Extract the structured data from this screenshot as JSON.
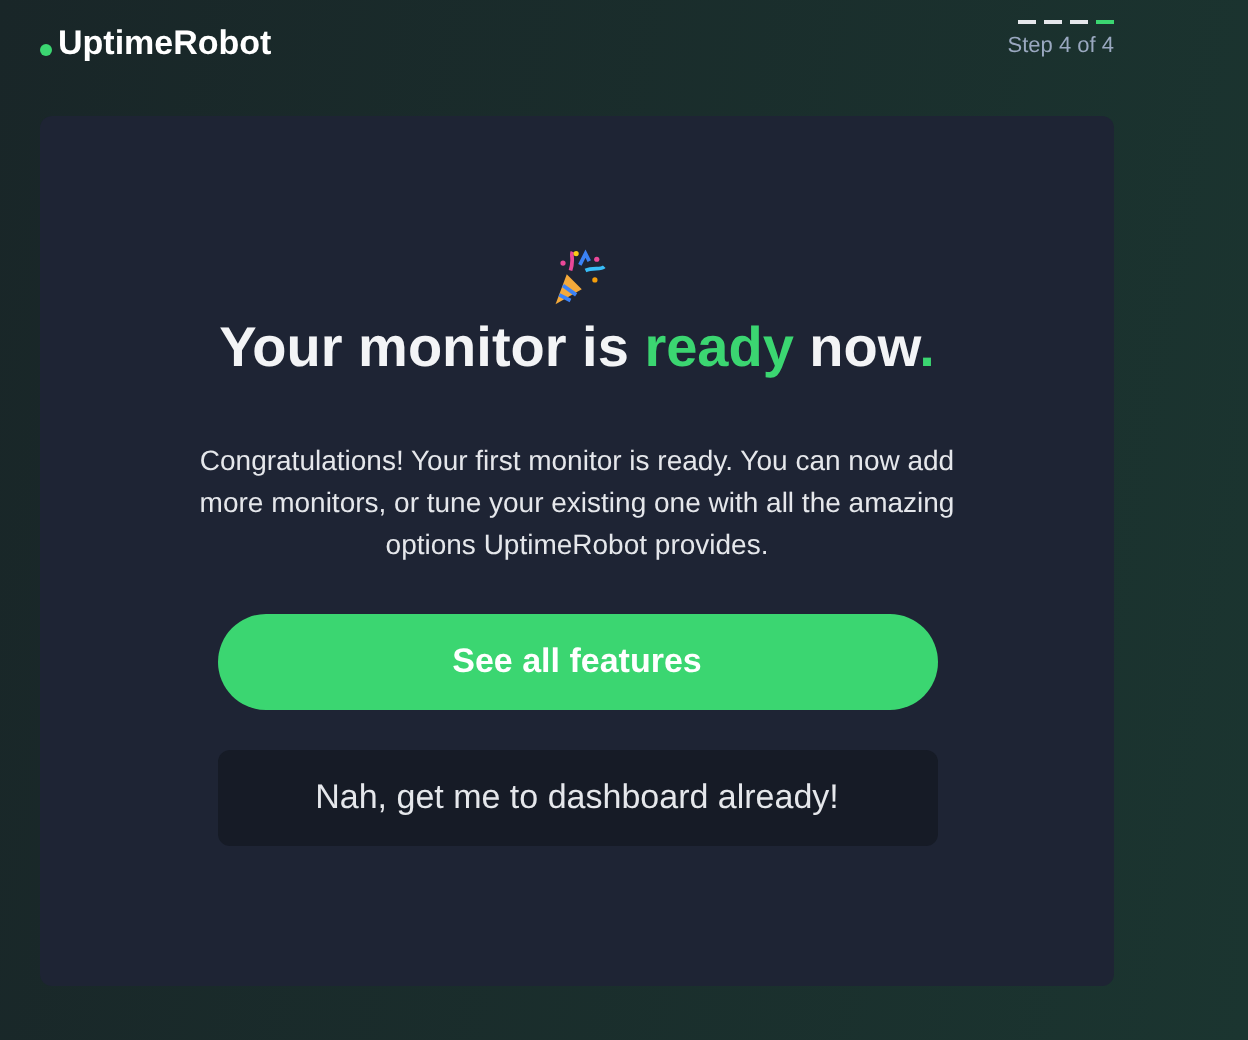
{
  "brand": {
    "name": "UptimeRobot"
  },
  "steps": [
    {
      "selected": false
    },
    {
      "selected": false
    },
    {
      "selected": false
    },
    {
      "selected": true
    }
  ],
  "step_label": "Step 4 of 4",
  "title": [
    {
      "text": "Your monitor is ",
      "highlight": false
    },
    {
      "text": "ready",
      "highlight": true
    },
    {
      "text": " now",
      "highlight": false
    },
    {
      "text": ".",
      "highlight": true
    }
  ],
  "message": "Congratulations! Your first monitor is ready. You can now add more monitors, or tune your existing one with all the amazing options UptimeRobot provides.",
  "buttons": [
    {
      "label": "See all features",
      "kind": "primary"
    },
    {
      "label": "Nah, get me to dashboard already!",
      "kind": "secondary"
    }
  ]
}
